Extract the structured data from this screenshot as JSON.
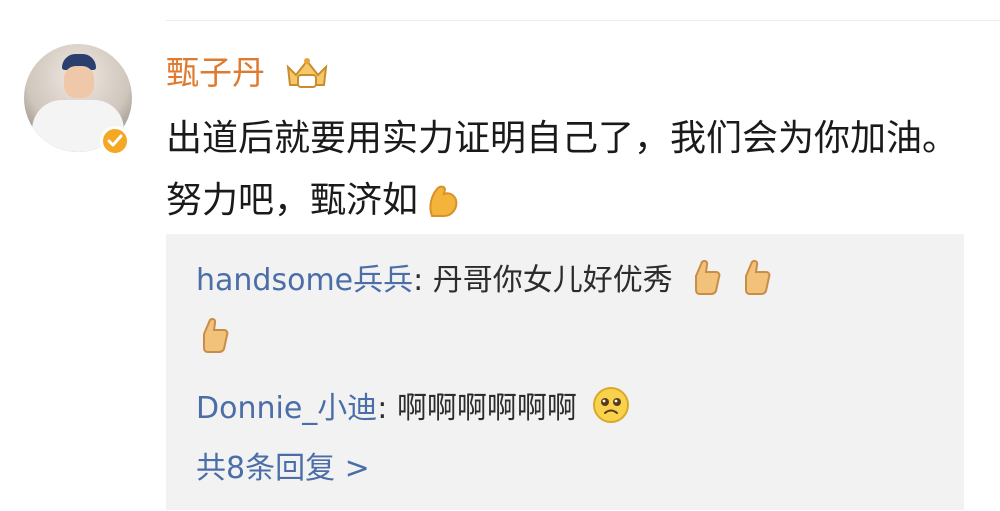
{
  "post": {
    "username": "甄子丹",
    "comment_text": "出道后就要用实力证明自己了，我们会为你加油。努力吧，甄济如",
    "comment_emoji": "flexed-biceps-icon"
  },
  "replies": {
    "items": [
      {
        "name": "handsome兵兵",
        "separator": ": ",
        "text": "丹哥你女儿好优秀",
        "emoji": "thumbs-up-icon",
        "emoji_count": 3
      },
      {
        "name": "Donnie_小迪",
        "separator": ": ",
        "text": "啊啊啊啊啊啊",
        "emoji": "pleading-face-icon",
        "emoji_count": 1
      }
    ],
    "more_label": "共8条回复 >"
  },
  "colors": {
    "username": "#e07a2e",
    "reply_name": "#4b6ea8",
    "reply_bg": "#f2f2f2",
    "verified_badge": "#f4a823"
  }
}
